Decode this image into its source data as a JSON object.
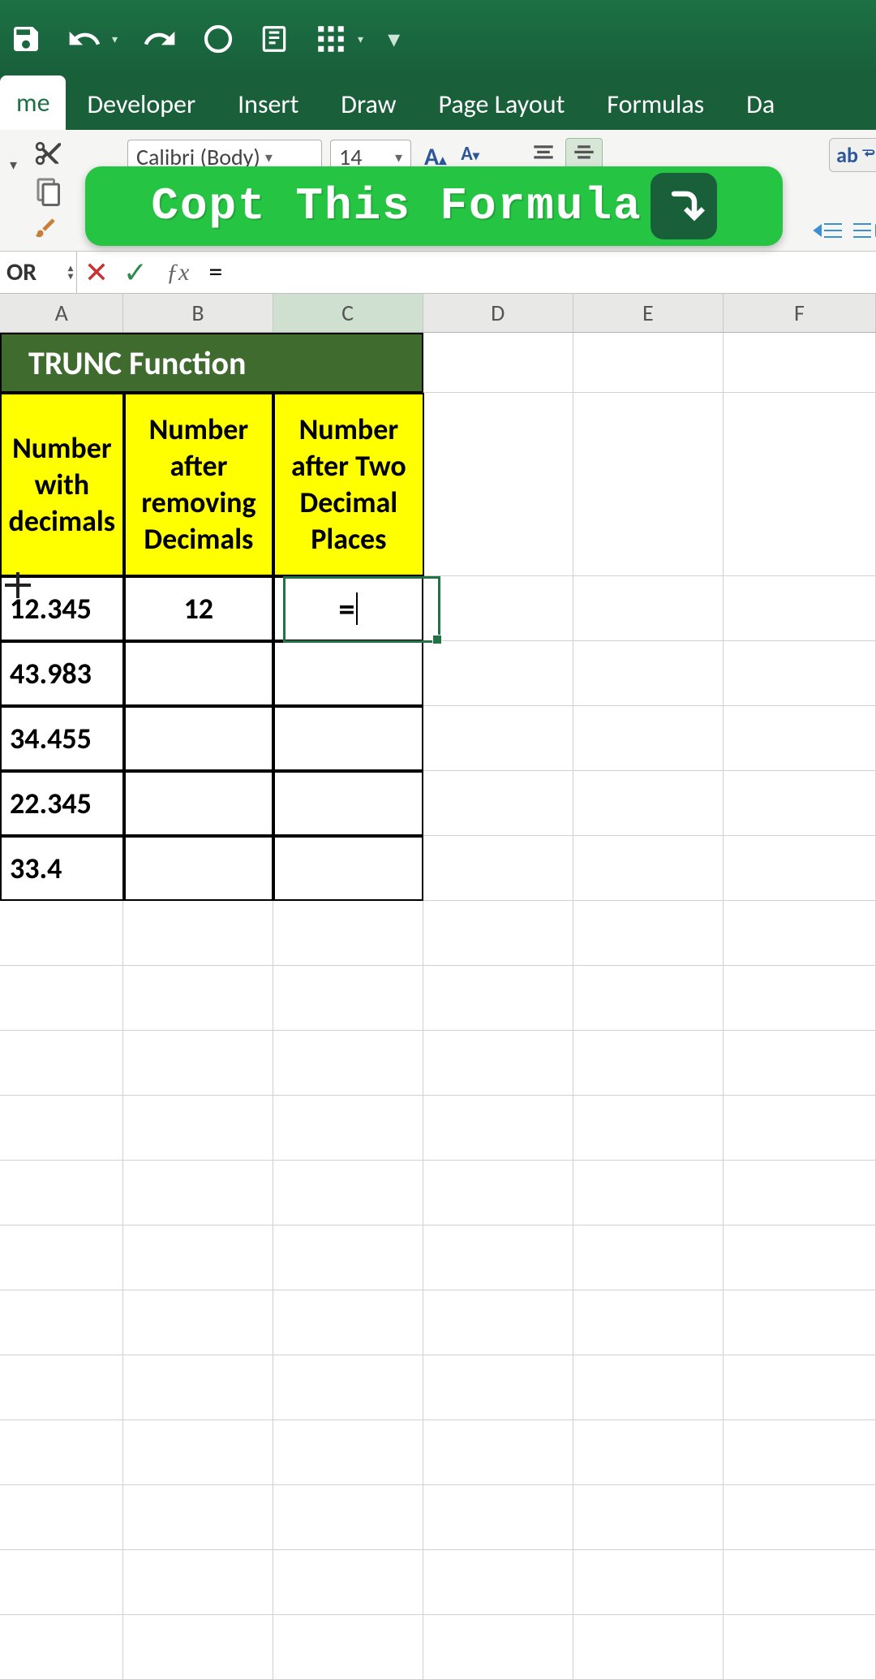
{
  "toolbar": {
    "font_name": "Calibri (Body)",
    "font_size": "14"
  },
  "tabs": {
    "home": "me",
    "developer": "Developer",
    "insert": "Insert",
    "draw": "Draw",
    "page_layout": "Page Layout",
    "formulas": "Formulas",
    "data": "Da"
  },
  "banner": {
    "text": "Copt This Formula"
  },
  "name_box": "OR",
  "formula_bar": "=",
  "columns": {
    "A": "A",
    "B": "B",
    "C": "C",
    "D": "D",
    "E": "E",
    "F": "F"
  },
  "sheet": {
    "title": "TRUNC Function",
    "headers": {
      "A": "Number with decimals",
      "B": "Number after removing Decimals",
      "C": "Number after Two Decimal Places"
    },
    "rows": [
      {
        "A": "12.345",
        "B": "12",
        "C": "="
      },
      {
        "A": "43.983",
        "B": "",
        "C": ""
      },
      {
        "A": "34.455",
        "B": "",
        "C": ""
      },
      {
        "A": "22.345",
        "B": "",
        "C": ""
      },
      {
        "A": "33.4",
        "B": "",
        "C": ""
      }
    ]
  },
  "wrap_label": "ab"
}
